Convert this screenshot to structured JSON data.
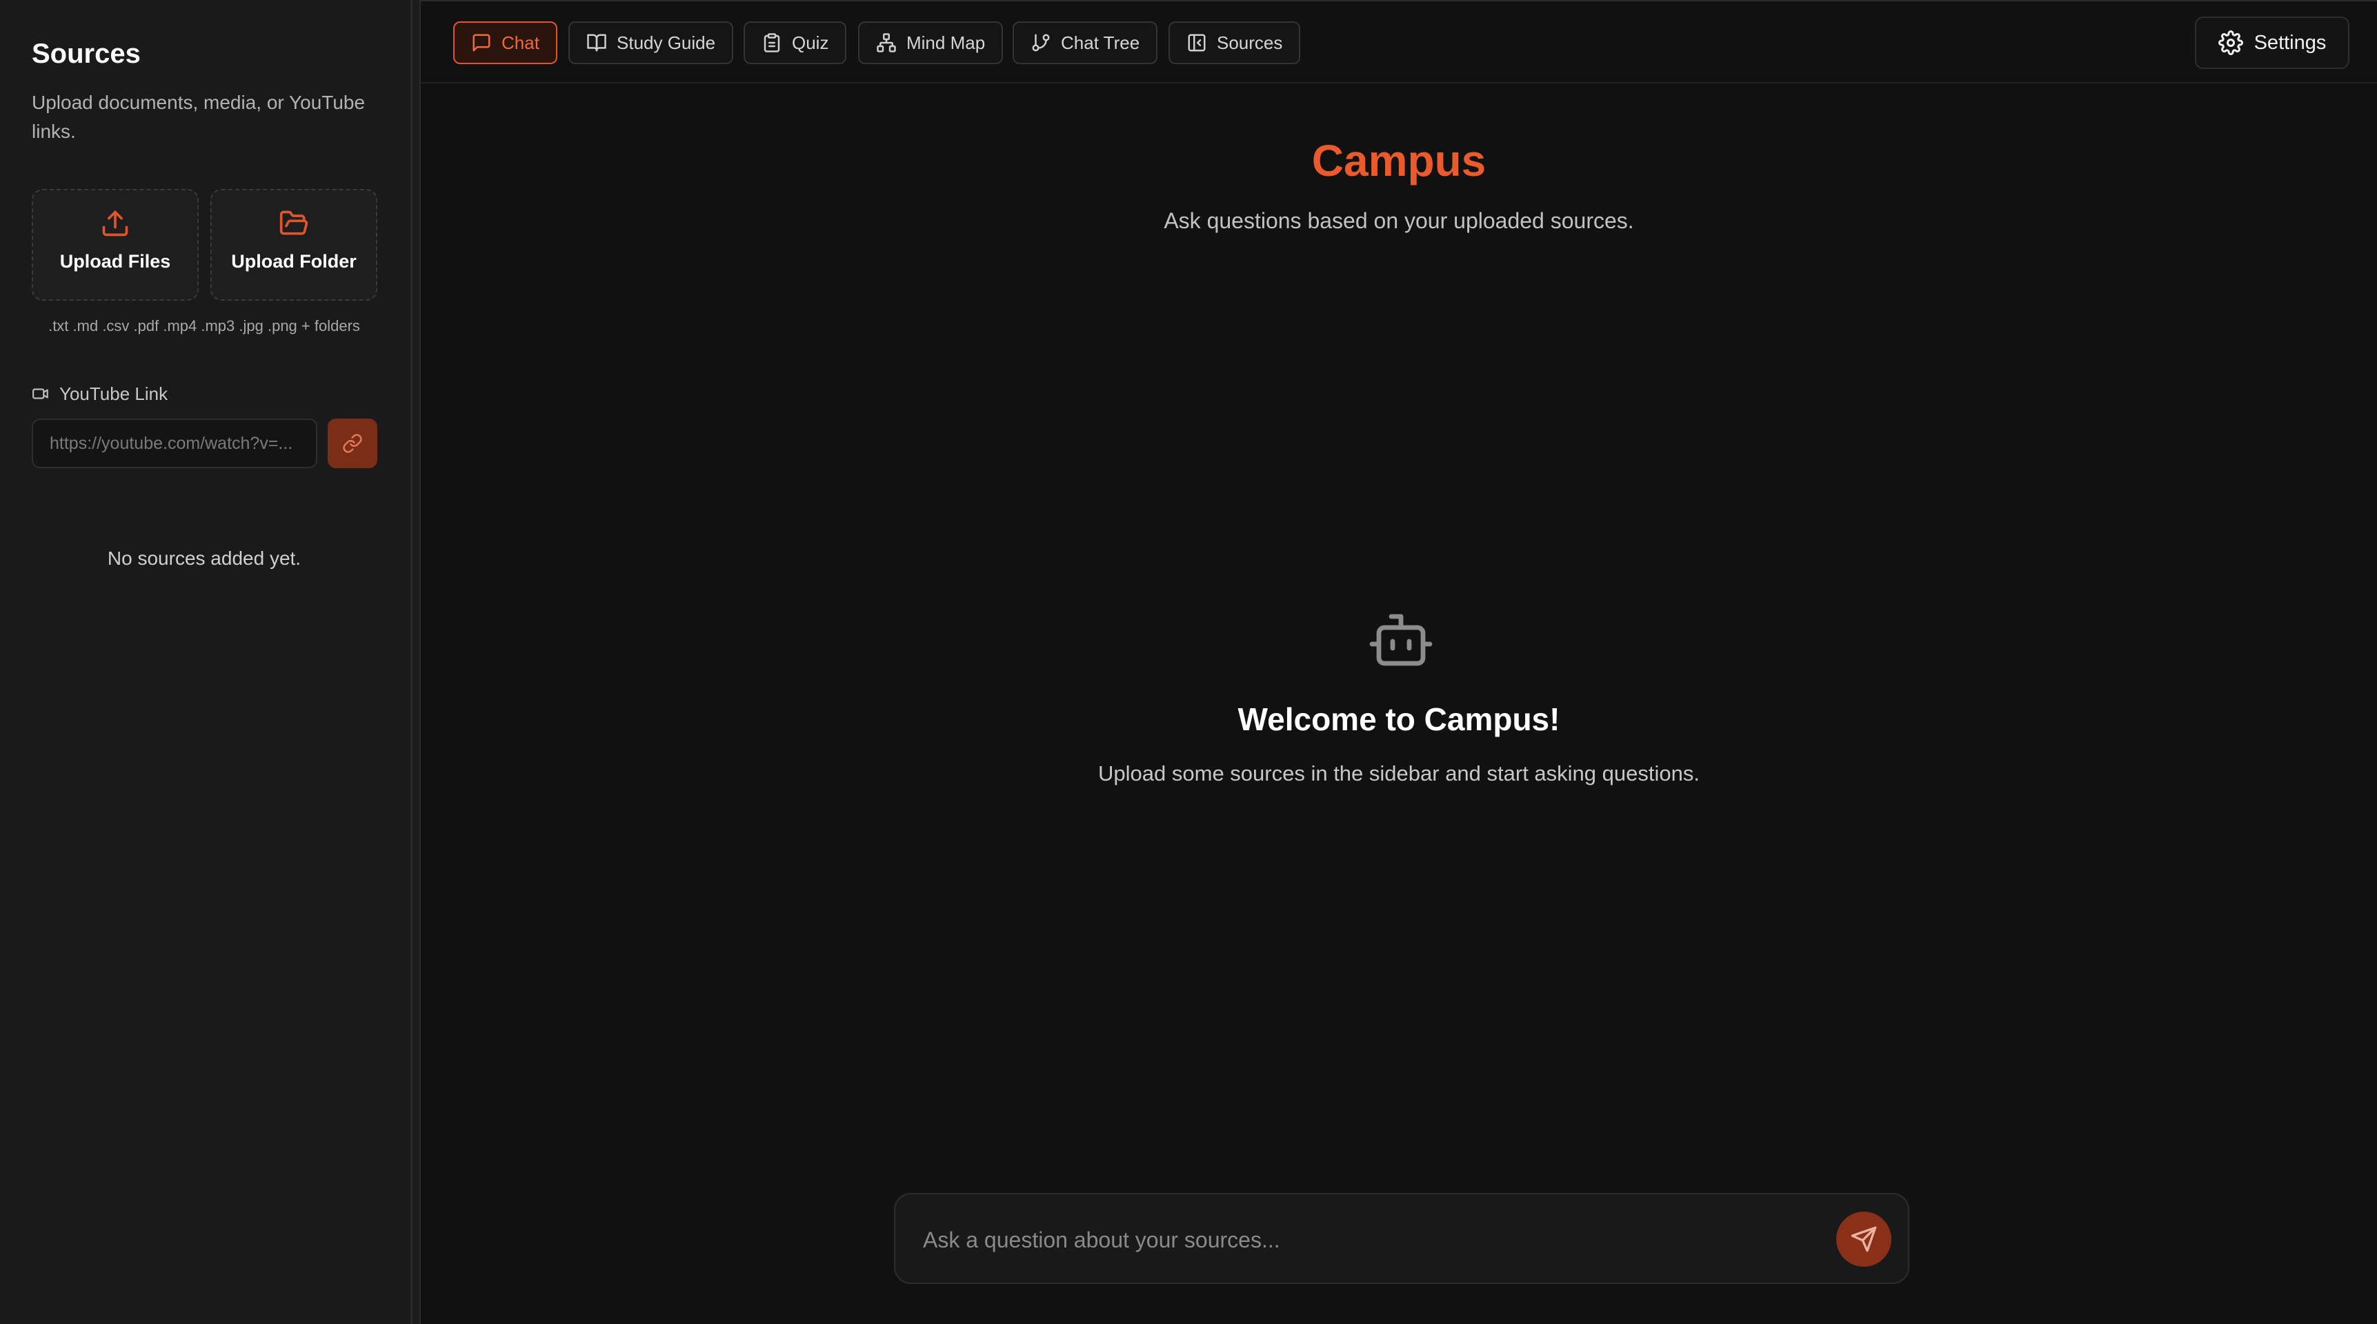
{
  "colors": {
    "accent": "#ea5a2c",
    "background": "#111111",
    "sidebar": "#1a1a1a",
    "muted_text": "#c2c2c2"
  },
  "sidebar": {
    "title": "Sources",
    "subtitle": "Upload documents, media, or YouTube links.",
    "upload_files": {
      "label": "Upload Files",
      "icon": "upload-icon"
    },
    "upload_folder": {
      "label": "Upload Folder",
      "icon": "folder-open-icon"
    },
    "formats": ".txt .md .csv .pdf .mp4 .mp3 .jpg .png + folders",
    "youtube": {
      "label": "YouTube Link",
      "icon": "video-icon",
      "placeholder": "https://youtube.com/watch?v=...",
      "value": "",
      "button_icon": "link-icon"
    },
    "empty_text": "No sources added yet."
  },
  "tabs": [
    {
      "label": "Chat",
      "icon": "message-square-icon",
      "active": true
    },
    {
      "label": "Study Guide",
      "icon": "book-open-icon",
      "active": false
    },
    {
      "label": "Quiz",
      "icon": "clipboard-icon",
      "active": false
    },
    {
      "label": "Mind Map",
      "icon": "network-icon",
      "active": false
    },
    {
      "label": "Chat Tree",
      "icon": "git-branch-icon",
      "active": false
    },
    {
      "label": "Sources",
      "icon": "panel-left-icon",
      "active": false
    }
  ],
  "settings": {
    "label": "Settings",
    "icon": "gear-icon"
  },
  "main": {
    "title": "Campus",
    "subtitle": "Ask questions based on your uploaded sources.",
    "welcome_icon": "bot-icon",
    "welcome_title": "Welcome to Campus!",
    "welcome_subtitle": "Upload some sources in the sidebar and start asking questions.",
    "chat": {
      "placeholder": "Ask a question about your sources...",
      "value": "",
      "send_icon": "send-icon"
    }
  }
}
